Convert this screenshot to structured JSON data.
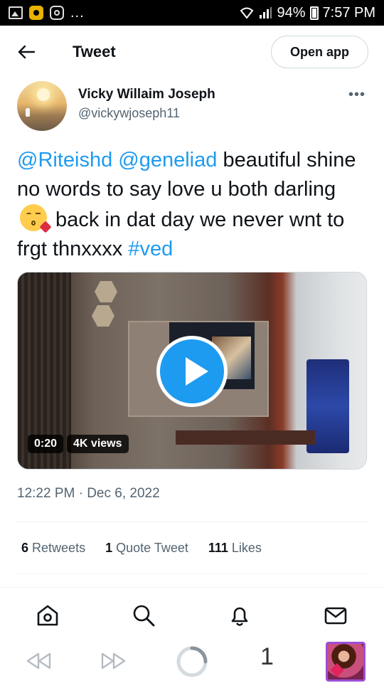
{
  "status_bar": {
    "more": "...",
    "battery": "94%",
    "time": "7:57 PM"
  },
  "header": {
    "title": "Tweet",
    "open_app_label": "Open app"
  },
  "author": {
    "name": "Vicky Willaim Joseph",
    "handle": "@vickywjoseph11",
    "more_label": "•••"
  },
  "tweet": {
    "mention_1": "@Riteishd",
    "mention_2": "@geneliad",
    "text_1": " beautiful shine no words to say love u both darling ",
    "text_2": " back in dat day we never wnt to frgt thnxxxx ",
    "hashtag": "#ved"
  },
  "video": {
    "duration": "0:20",
    "views": "4K views"
  },
  "timestamp": "12:22 PM · Dec 6, 2022",
  "stats": {
    "retweets_count": "6",
    "retweets_label": "Retweets",
    "quotes_count": "1",
    "quotes_label": "Quote Tweet",
    "likes_count": "111",
    "likes_label": "Likes"
  },
  "bottom_nav": [
    "home-icon",
    "search-icon",
    "notifications-icon",
    "messages-icon"
  ],
  "browser_bar": {
    "tab_count": "1"
  },
  "colors": {
    "accent": "#1d9bf0",
    "text": "#0f1419",
    "secondary": "#536471"
  }
}
